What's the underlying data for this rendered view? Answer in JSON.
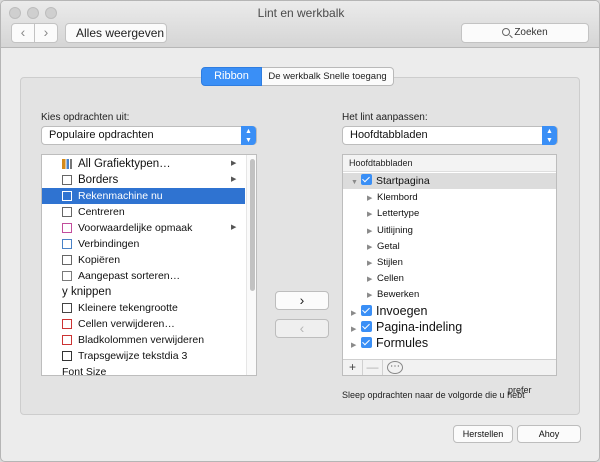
{
  "window": {
    "title": "Lint en werkbalk"
  },
  "toolbar": {
    "back_label": "‹",
    "forward_label": "›",
    "show_all_label": "Alles weergeven",
    "search_label": "Zoeken"
  },
  "tabs": [
    {
      "label": "Ribbon",
      "active": true
    },
    {
      "label": "De werkbalk Snelle toegang",
      "active": false
    }
  ],
  "left": {
    "label": "Kies opdrachten uit:",
    "dropdown_value": "Populaire opdrachten",
    "commands": [
      {
        "label": "All  Grafiektypen…",
        "icon": "chart-icon",
        "submenu": true
      },
      {
        "label": "Borders",
        "icon": "borders-icon",
        "submenu": true
      },
      {
        "label": "Rekenmachine nu",
        "icon": "calculator-icon",
        "selected": true
      },
      {
        "label": "Centreren",
        "icon": "align-center-icon"
      },
      {
        "label": "Voorwaardelijke opmaak",
        "icon": "conditional-format-icon",
        "submenu": true
      },
      {
        "label": "Verbindingen",
        "icon": "connections-icon"
      },
      {
        "label": "Kopiëren",
        "icon": "copy-icon"
      },
      {
        "label": "Aangepast sorteren…",
        "icon": "sort-icon"
      },
      {
        "label": "y knippen",
        "icon": ""
      },
      {
        "label": "Kleinere tekengrootte",
        "icon": "decrease-font-icon"
      },
      {
        "label": "Cellen verwijderen…",
        "icon": "delete-cells-icon"
      },
      {
        "label": "Bladkolommen verwijderen",
        "icon": "delete-columns-icon"
      },
      {
        "label": "Trapsgewijze tekstdia 3",
        "icon": "text-icon"
      },
      {
        "label": "Font Size",
        "icon": ""
      }
    ]
  },
  "right": {
    "label": "Het lint aanpassen:",
    "dropdown_value": "Hoofdtabbladen",
    "tree_header": "Hoofdtabbladen",
    "tree": [
      {
        "label": "Startpagina",
        "level": 0,
        "expanded": true,
        "checked": true,
        "big": false
      },
      {
        "label": "Klembord",
        "level": 1
      },
      {
        "label": "Lettertype",
        "level": 1
      },
      {
        "label": "Uitlijning",
        "level": 1
      },
      {
        "label": "Getal",
        "level": 1
      },
      {
        "label": "Stijlen",
        "level": 1
      },
      {
        "label": "Cellen",
        "level": 1
      },
      {
        "label": "Bewerken",
        "level": 1
      },
      {
        "label": "Invoegen",
        "level": 0,
        "expanded": false,
        "checked": true,
        "big": true
      },
      {
        "label": "Pagina-indeling",
        "level": 0,
        "expanded": false,
        "checked": true,
        "big": true
      },
      {
        "label": "Formules",
        "level": 0,
        "expanded": false,
        "checked": true,
        "big": true
      }
    ],
    "toolbar": {
      "add": "+",
      "remove": "—",
      "more": "⋯"
    },
    "hint": "Sleep opdrachten naar de volgorde die u hebt",
    "hint_overlay": "prefer"
  },
  "buttons": {
    "add": "›",
    "remove": "‹",
    "reset": "Herstellen",
    "ok": "Ahoy"
  }
}
